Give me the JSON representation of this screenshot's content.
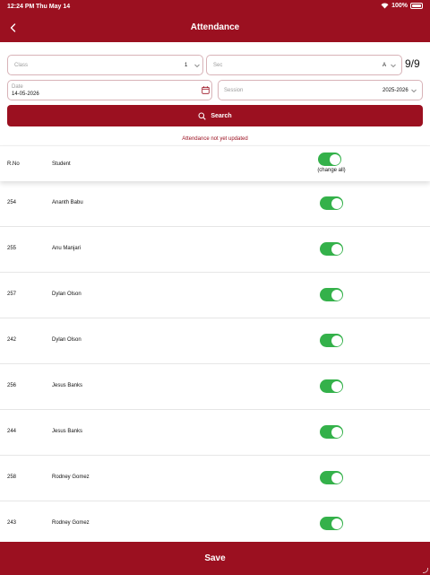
{
  "status_bar": {
    "time": "12:24 PM",
    "date": "Thu May 14",
    "battery": "100%"
  },
  "header": {
    "title": "Attendance"
  },
  "filters": {
    "class_label": "Class",
    "class_value": "1",
    "sec_label": "Sec",
    "sec_value": "A",
    "count": "9/9",
    "date_label": "Date",
    "date_value": "14-05-2026",
    "session_label": "Session",
    "session_value": "2025-2026"
  },
  "search": {
    "label": "Search"
  },
  "notice": "Attendance not yet updated",
  "table": {
    "col_rno": "R.No",
    "col_student": "Student",
    "change_all_label": "(change all)",
    "change_all_on": true,
    "rows": [
      {
        "rno": "254",
        "name": "Ananth Babu",
        "present": true
      },
      {
        "rno": "255",
        "name": "Anu Manjari",
        "present": true
      },
      {
        "rno": "257",
        "name": "Dylan Olson",
        "present": true
      },
      {
        "rno": "242",
        "name": "Dylan Olson",
        "present": true
      },
      {
        "rno": "256",
        "name": "Jesus Banks",
        "present": true
      },
      {
        "rno": "244",
        "name": "Jesus Banks",
        "present": true
      },
      {
        "rno": "258",
        "name": "Rodney Gomez",
        "present": true
      },
      {
        "rno": "243",
        "name": "Rodney Gomez",
        "present": true
      }
    ]
  },
  "footer": {
    "save_label": "Save"
  },
  "colors": {
    "brand": "#9b1020",
    "toggle_on": "#34b14a"
  }
}
